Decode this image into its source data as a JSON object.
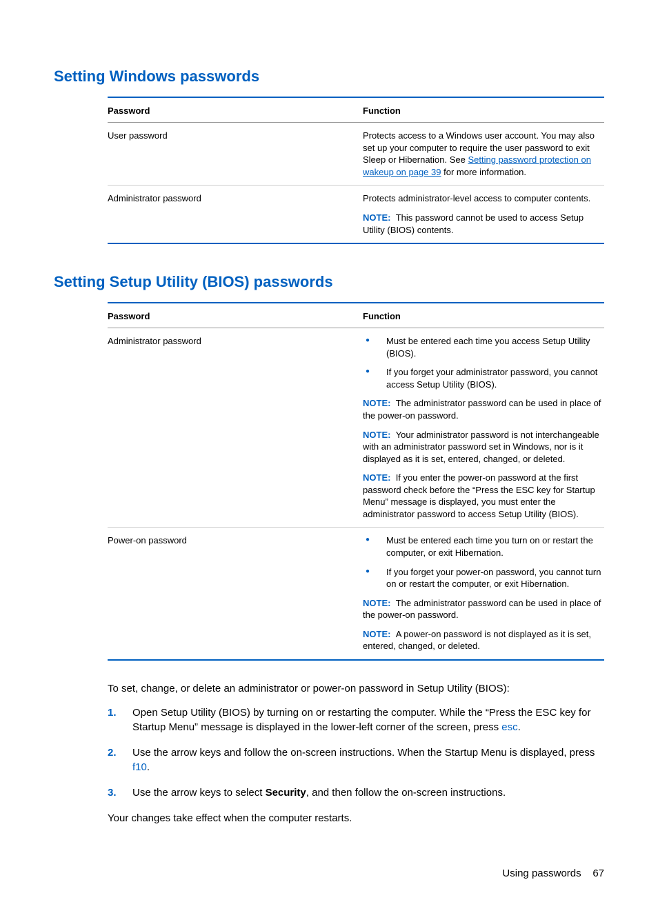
{
  "section1": {
    "heading": "Setting Windows passwords",
    "table": {
      "header_pass": "Password",
      "header_func": "Function",
      "row1": {
        "pass": "User password",
        "func_pre": "Protects access to a Windows user account. You may also set up your computer to require the user password to exit Sleep or Hibernation. See ",
        "link": "Setting password protection on wakeup on page 39",
        "func_post": " for more information."
      },
      "row2": {
        "pass": "Administrator password",
        "func1": "Protects administrator-level access to computer contents.",
        "note_label": "NOTE:",
        "note_text": "This password cannot be used to access Setup Utility (BIOS) contents."
      }
    }
  },
  "section2": {
    "heading": "Setting Setup Utility (BIOS) passwords",
    "table": {
      "header_pass": "Password",
      "header_func": "Function",
      "row1": {
        "pass": "Administrator password",
        "b1": "Must be entered each time you access Setup Utility (BIOS).",
        "b2": "If you forget your administrator password, you cannot access Setup Utility (BIOS).",
        "note1_label": "NOTE:",
        "note1_text": "The administrator password can be used in place of the power-on password.",
        "note2_label": "NOTE:",
        "note2_text": "Your administrator password is not interchangeable with an administrator password set in Windows, nor is it displayed as it is set, entered, changed, or deleted.",
        "note3_label": "NOTE:",
        "note3_text": "If you enter the power-on password at the first password check before the “Press the ESC key for Startup Menu” message is displayed, you must enter the administrator password to access Setup Utility (BIOS)."
      },
      "row2": {
        "pass": "Power-on password",
        "b1": "Must be entered each time you turn on or restart the computer, or exit Hibernation.",
        "b2": "If you forget your power-on password, you cannot turn on or restart the computer, or exit Hibernation.",
        "note1_label": "NOTE:",
        "note1_text": "The administrator password can be used in place of the power-on password.",
        "note2_label": "NOTE:",
        "note2_text": "A power-on password is not displayed as it is set, entered, changed, or deleted."
      }
    }
  },
  "body": {
    "intro": "To set, change, or delete an administrator or power-on password in Setup Utility (BIOS):",
    "step1_pre": "Open Setup Utility (BIOS) by turning on or restarting the computer. While the “Press the ESC key for Startup Menu” message is displayed in the lower-left corner of the screen, press ",
    "step1_key": "esc",
    "step1_post": ".",
    "step2_pre": "Use the arrow keys and follow the on-screen instructions. When the Startup Menu is displayed, press ",
    "step2_key": "f10",
    "step2_post": ".",
    "step3_pre": "Use the arrow keys to select ",
    "step3_bold": "Security",
    "step3_post": ", and then follow the on-screen instructions.",
    "outro": "Your changes take effect when the computer restarts."
  },
  "footer": {
    "section": "Using passwords",
    "page": "67"
  },
  "nums": {
    "n1": "1.",
    "n2": "2.",
    "n3": "3."
  }
}
